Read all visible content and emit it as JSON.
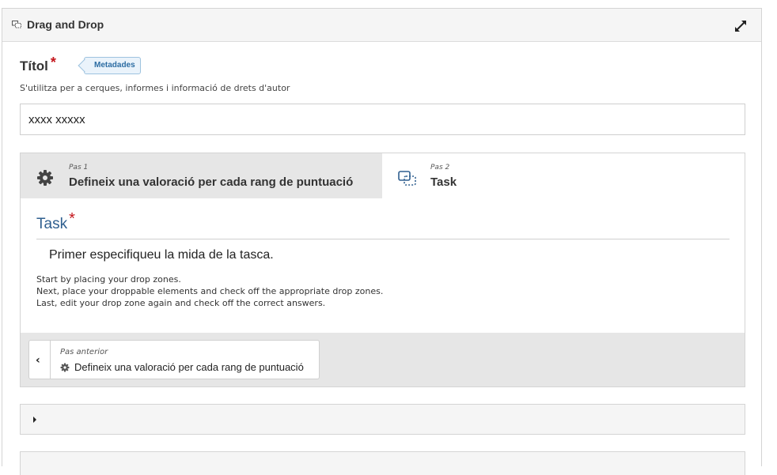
{
  "header": {
    "title": "Drag and Drop",
    "icon": "drag-drop-icon",
    "expand_icon": "expand-arrows-icon"
  },
  "title_field": {
    "label": "Títol",
    "required_mark": "*",
    "metadata_label": "Metadades",
    "description": "S'utilitza per a cerques, informes i informació de drets d'autor",
    "value": "xxxx xxxxx"
  },
  "wizard": {
    "steps": [
      {
        "number": "Pas 1",
        "label": "Defineix una valoració per cada rang de puntuació",
        "icon": "gear-icon"
      },
      {
        "number": "Pas 2",
        "label": "Task",
        "icon": "drop-zone-icon"
      }
    ],
    "active_step": 2,
    "task": {
      "title": "Task",
      "required_mark": "*",
      "intro": "Primer especifiqueu la mida de la tasca.",
      "help_lines": [
        "Start by placing your drop zones.",
        "Next, place your droppable elements and check off the appropriate drop zones.",
        "Last, edit your drop zone again and check off the correct answers."
      ]
    },
    "previous": {
      "caption": "Pas anterior",
      "label": "Defineix una valoració per cada rang de puntuació",
      "chevron": "‹"
    }
  },
  "colors": {
    "accent": "#2f5f8f",
    "required": "#c4161c",
    "badge_text": "#2d6da3"
  }
}
